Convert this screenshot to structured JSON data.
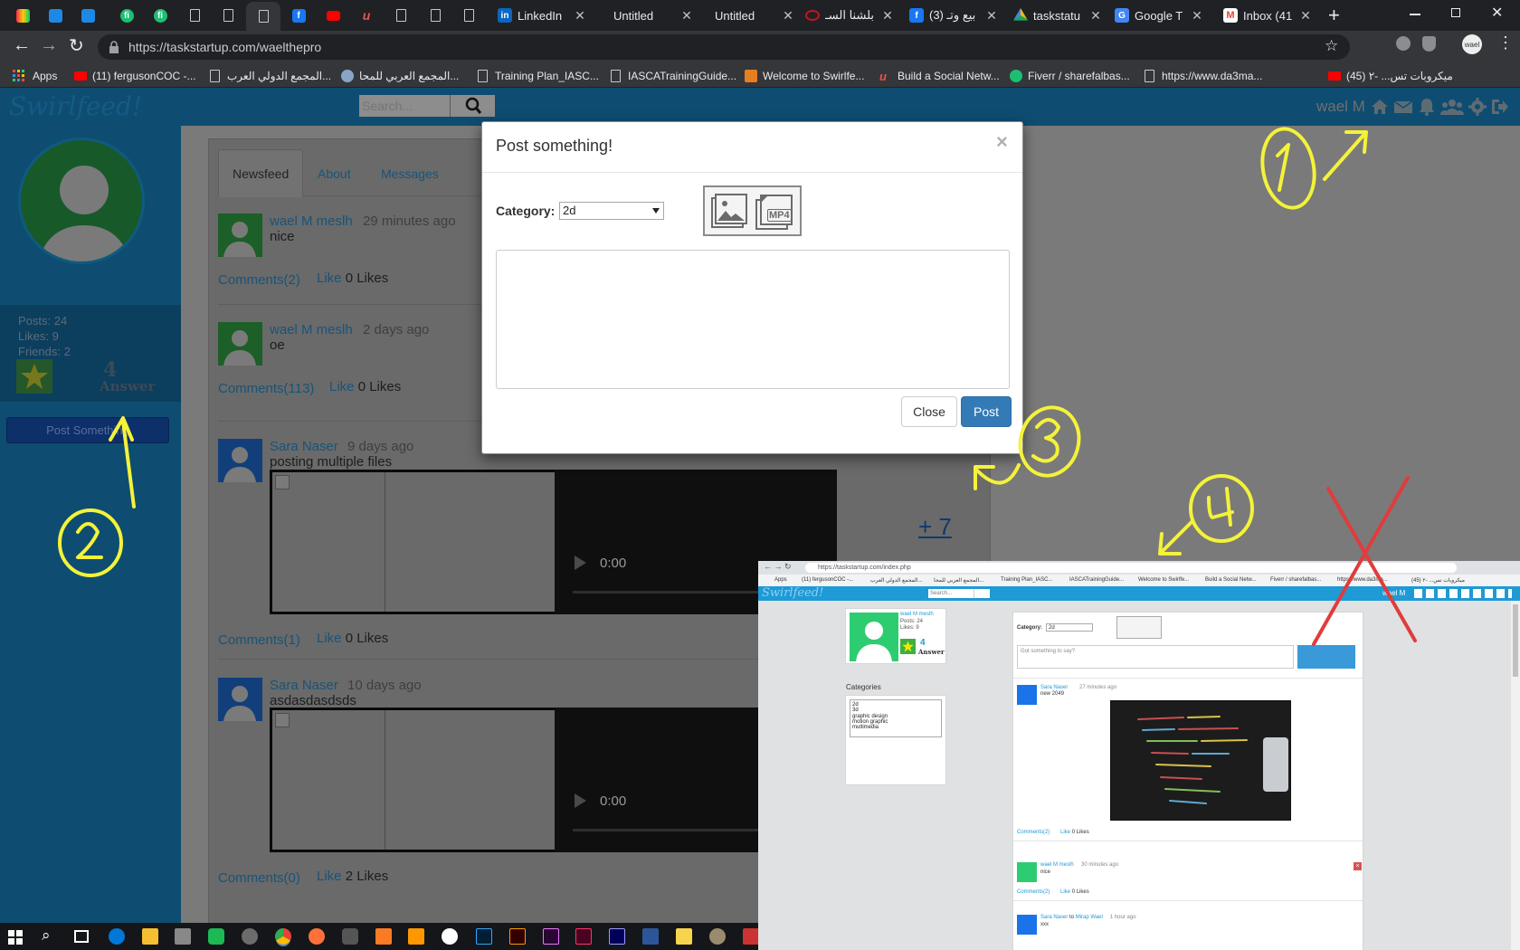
{
  "browser": {
    "tabs": [
      {
        "title": "LinkedIn",
        "favicon": "linkedin-icon",
        "color": "#0a66c2"
      },
      {
        "title": "Untitled",
        "favicon": "blank-icon",
        "color": "#202124"
      },
      {
        "title": "Untitled",
        "favicon": "blank-icon",
        "color": "#202124"
      },
      {
        "title": "بلشنا السـ",
        "favicon": "toyota-icon",
        "color": "#c4161c"
      },
      {
        "title": "(3) بيع وتـ",
        "favicon": "facebook-icon",
        "color": "#1877f2"
      },
      {
        "title": "taskstatu",
        "favicon": "google-drive-icon",
        "color": "#1fa463"
      },
      {
        "title": "Google T",
        "favicon": "google-translate-icon",
        "color": "#4285f4"
      },
      {
        "title": "Inbox (41",
        "favicon": "gmail-icon",
        "color": "#ea4335"
      }
    ],
    "new_tab": "+",
    "url": "https://taskstartup.com/waelthepro",
    "bookmarks": [
      "Apps",
      "(11) fergusonCOC -...",
      "المجمع الدولي العرب...",
      "المجمع العربي للمحا...",
      "Training Plan_IASC...",
      "IASCATrainingGuide...",
      "Welcome to Swirlfe...",
      "Build a Social Netw...",
      "Fiverr / sharefalbas...",
      "https://www.da3ma...",
      "(45) ميكروبات تس... -٢"
    ]
  },
  "site": {
    "logo": "Swirlfeed!",
    "search_placeholder": "Search...",
    "username": "wael M",
    "nav_icons": [
      "home-icon",
      "envelope-icon",
      "bell-icon",
      "users-icon",
      "gear-icon",
      "sign-out-icon"
    ]
  },
  "sidebar": {
    "posts": "Posts: 24",
    "likes": "Likes: 9",
    "friends": "Friends: 2",
    "answer_count": "4",
    "answer_label": "Answer",
    "post_button": "Post Something"
  },
  "tabs": [
    "Newsfeed",
    "About",
    "Messages"
  ],
  "posts": [
    {
      "author": "wael M meslh",
      "time": "29 minutes ago",
      "text": "nice",
      "comments": "Comments(2)",
      "like": "Like",
      "likes": "0 Likes"
    },
    {
      "author": "wael M meslh",
      "time": "2 days ago",
      "text": "oe",
      "comments": "Comments(113)",
      "like": "Like",
      "likes": "0 Likes"
    },
    {
      "author": "Sara Naser",
      "time": "9 days ago",
      "text": "posting multiple files",
      "video_time": "0:00",
      "more": "+ 7",
      "comments": "Comments(1)",
      "like": "Like",
      "likes": "0 Likes"
    },
    {
      "author": "Sara Naser",
      "time": "10 days ago",
      "text": "asdasdasdsds",
      "video_time": "0:00",
      "comments": "Comments(0)",
      "like": "Like",
      "likes": "2 Likes"
    }
  ],
  "modal": {
    "title": "Post something!",
    "close_x": "×",
    "category_label": "Category:",
    "category_value": "2d",
    "mp4_label": "MP4",
    "close_button": "Close",
    "post_button": "Post"
  },
  "inset": {
    "url": "https://taskstartup.com/index.php",
    "bookmarks": [
      "Apps",
      "(11) fergusonCOC -...",
      "المجمع الدولي العرب...",
      "المجمع العربي للمحا...",
      "Training Plan_IASC...",
      "IASCATrainingGuide...",
      "Welcome to Swirlfe...",
      "Build a Social Netw...",
      "Fiverr / sharefalbas...",
      "https://www.da3ma...",
      "(45) ميكروبات تس... -٢"
    ],
    "logo": "Swirlfeed!",
    "search_placeholder": "Search...",
    "username": "wael M",
    "profile_name": "wael M meslh",
    "posts": "Posts: 24",
    "likes": "Likes: 9",
    "answer_count": "4",
    "answer_label": "Answer",
    "categories_title": "Categories",
    "categories": [
      "2d",
      "3d",
      "graphic design",
      "motion graphic",
      "multimedia"
    ],
    "category_label": "Category:",
    "category_value": "2d",
    "post_placeholder": "Got something to say?",
    "feed": [
      {
        "author": "Sara Naser",
        "time": "27 minutes ago",
        "text": "new 2049",
        "comments": "Comments(2)",
        "like": "Like",
        "likes": "0 Likes"
      },
      {
        "author": "wael M meslh",
        "time": "30 minutes ago",
        "text": "nice",
        "comments": "Comments(2)",
        "like": "Like",
        "likes": "0 Likes"
      },
      {
        "author": "Sara Naser",
        "to": "to",
        "recipient": "Mirap Wael",
        "time": "1 hour ago",
        "text": "xxx"
      }
    ]
  },
  "annotations": [
    "1",
    "2",
    "3",
    "4"
  ],
  "colors": {
    "annotation": "#f4f23a",
    "cross": "#e03c3c",
    "navbar": "#0e4d71",
    "overlay": "#7a7a7a",
    "primary": "#337ab7"
  }
}
